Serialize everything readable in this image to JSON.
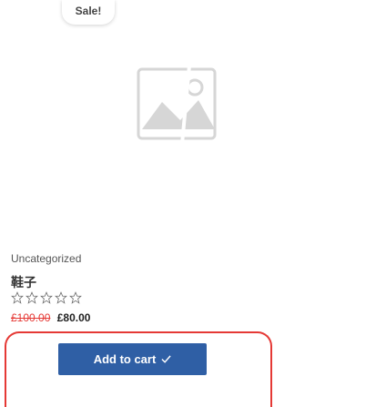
{
  "product": {
    "badge": "Sale!",
    "image_alt": "placeholder-image",
    "category": "Uncategorized",
    "title": "鞋子",
    "rating": 0,
    "rating_max": 5,
    "price_old": "£100.00",
    "price_new": "£80.00",
    "cart_label": "Add to cart",
    "colors": {
      "button": "#2f5fa5",
      "badge_text": "#444444",
      "old_price": "#e53935",
      "frame": "#e53935",
      "placeholder": "#dadada"
    }
  }
}
